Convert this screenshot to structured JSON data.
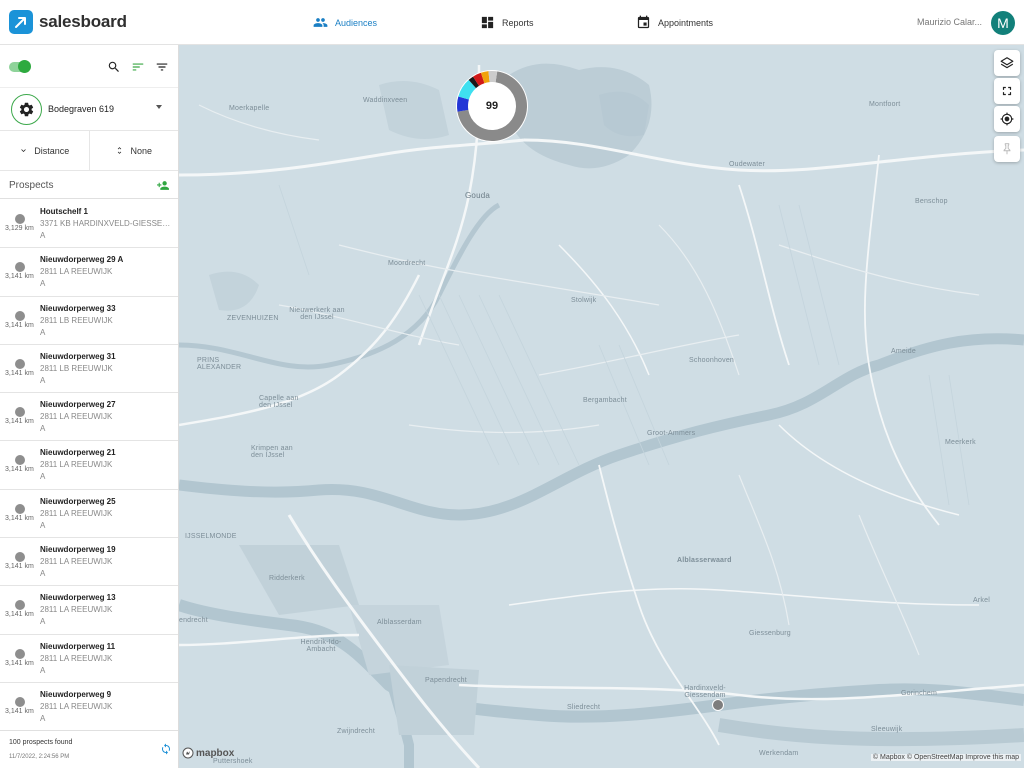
{
  "app": {
    "name": "salesboard"
  },
  "nav": {
    "audiences": "Audiences",
    "reports": "Reports",
    "appointments": "Appointments"
  },
  "user": {
    "name": "Maurizio Calar...",
    "initial": "M"
  },
  "sidebar": {
    "territory": "Bodegraven 619",
    "sort": {
      "primary": "Distance",
      "secondary": "None"
    },
    "prospects_title": "Prospects",
    "items": [
      {
        "title": "Houtschelf 1",
        "address": "3371 KB HARDINXVELD-GIESSENDAM",
        "type": "A",
        "distance": "3,129 km"
      },
      {
        "title": "Nieuwdorperweg 29 A",
        "address": "2811 LA REEUWIJK",
        "type": "A",
        "distance": "3,141 km"
      },
      {
        "title": "Nieuwdorperweg 33",
        "address": "2811 LB REEUWIJK",
        "type": "A",
        "distance": "3,141 km"
      },
      {
        "title": "Nieuwdorperweg 31",
        "address": "2811 LB REEUWIJK",
        "type": "A",
        "distance": "3,141 km"
      },
      {
        "title": "Nieuwdorperweg 27",
        "address": "2811 LA REEUWIJK",
        "type": "A",
        "distance": "3,141 km"
      },
      {
        "title": "Nieuwdorperweg 21",
        "address": "2811 LA REEUWIJK",
        "type": "A",
        "distance": "3,141 km"
      },
      {
        "title": "Nieuwdorperweg 25",
        "address": "2811 LA REEUWIJK",
        "type": "A",
        "distance": "3,141 km"
      },
      {
        "title": "Nieuwdorperweg 19",
        "address": "2811 LA REEUWIJK",
        "type": "A",
        "distance": "3,141 km"
      },
      {
        "title": "Nieuwdorperweg 13",
        "address": "2811 LA REEUWIJK",
        "type": "A",
        "distance": "3,141 km"
      },
      {
        "title": "Nieuwdorperweg 11",
        "address": "2811 LA REEUWIJK",
        "type": "A",
        "distance": "3,141 km"
      },
      {
        "title": "Nieuwdorperweg 9",
        "address": "2811 LA REEUWIJK",
        "type": "A",
        "distance": "3,141 km"
      }
    ],
    "footer": {
      "count": "100 prospects found",
      "timestamp": "11/7/2022, 2:24:56 PM"
    }
  },
  "map": {
    "cluster_count": "99",
    "cluster_segments": [
      {
        "color": "#8a8a8a",
        "share": 0.7
      },
      {
        "color": "#2336d6",
        "share": 0.07
      },
      {
        "color": "#3fe0f0",
        "share": 0.09
      },
      {
        "color": "#1a1a1a",
        "share": 0.025
      },
      {
        "color": "#d01818",
        "share": 0.04
      },
      {
        "color": "#f0a20a",
        "share": 0.035
      },
      {
        "color": "#cccccc",
        "share": 0.04
      }
    ],
    "places": {
      "waddinxveen": "Waddinxveen",
      "moerkapelle": "Moerkapelle",
      "gouda": "Gouda",
      "oudewater": "Oudewater",
      "montfoort": "Montfoort",
      "benschop": "Benschop",
      "moordrecht": "Moordrecht",
      "stolwijk": "Stolwijk",
      "nieuwerkerk": "Nieuwerkerk aan den IJssel",
      "zevenhuizen": "ZEVENHUIZEN",
      "prins_alexander": "PRINS ALEXANDER",
      "capelle": "Capelle aan den IJssel",
      "krimpen": "Krimpen aan den IJssel",
      "schoonhoven": "Schoonhoven",
      "bergambacht": "Bergambacht",
      "ameide": "Ameide",
      "groot_ammers": "Groot-Ammers",
      "meerkerk": "Meerkerk",
      "ijsselmonde": "IJSSELMONDE",
      "ridderkerk": "Ridderkerk",
      "alblasserwaard": "Alblasserwaard",
      "alblasserdam": "Alblasserdam",
      "giessenburg": "Giessenburg",
      "arkel": "Arkel",
      "hendrik_ido": "Hendrik-Ido-Ambacht",
      "papendrecht": "Papendrecht",
      "zwijndrecht": "Zwijndrecht",
      "sliedrecht": "Sliedrecht",
      "hardinxveld": "Hardinxveld-Giessendam",
      "gorinchem": "Gorinchem",
      "sleeuwijk": "Sleeuwijk",
      "werkendam": "Werkendam",
      "rendrecht": "endrecht",
      "puttershoek": "Puttershoek"
    },
    "mapbox_logo": "mapbox",
    "attribution": "© Mapbox © OpenStreetMap  Improve this map"
  }
}
